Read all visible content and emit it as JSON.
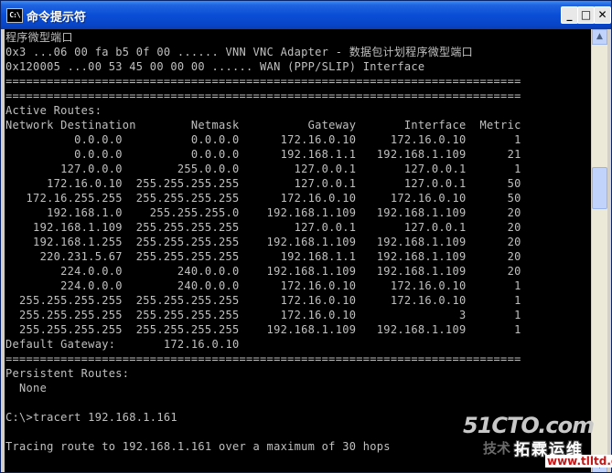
{
  "window": {
    "title": "命令提示符",
    "icon_text": "C:\\",
    "controls": {
      "minimize": "_",
      "maximize": "□",
      "close": "✕"
    }
  },
  "console": {
    "lines": [
      "程序微型端口",
      "0x3 ...06 00 fa b5 0f 00 ...... VNN VNC Adapter - 数据包计划程序微型端口",
      "0x120005 ...00 53 45 00 00 00 ...... WAN (PPP/SLIP) Interface",
      "===========================================================================",
      "===========================================================================",
      "Active Routes:",
      "Network Destination        Netmask          Gateway       Interface  Metric",
      "          0.0.0.0          0.0.0.0      172.16.0.10     172.16.0.10       1",
      "          0.0.0.0          0.0.0.0      192.168.1.1   192.168.1.109      21",
      "        127.0.0.0        255.0.0.0        127.0.0.1       127.0.0.1       1",
      "      172.16.0.10  255.255.255.255        127.0.0.1       127.0.0.1      50",
      "   172.16.255.255  255.255.255.255      172.16.0.10     172.16.0.10      50",
      "      192.168.1.0    255.255.255.0    192.168.1.109   192.168.1.109      20",
      "    192.168.1.109  255.255.255.255        127.0.0.1       127.0.0.1      20",
      "    192.168.1.255  255.255.255.255    192.168.1.109   192.168.1.109      20",
      "     220.231.5.67  255.255.255.255      192.168.1.1   192.168.1.109      20",
      "        224.0.0.0        240.0.0.0    192.168.1.109   192.168.1.109      20",
      "        224.0.0.0        240.0.0.0      172.16.0.10     172.16.0.10       1",
      "  255.255.255.255  255.255.255.255      172.16.0.10     172.16.0.10       1",
      "  255.255.255.255  255.255.255.255      172.16.0.10               3       1",
      "  255.255.255.255  255.255.255.255    192.168.1.109   192.168.1.109       1",
      "Default Gateway:       172.16.0.10",
      "===========================================================================",
      "Persistent Routes:",
      "  None",
      "",
      "C:\\>tracert 192.168.1.161",
      "",
      "Tracing route to 192.168.1.161 over a maximum of 30 hops"
    ]
  },
  "scrollbar": {
    "up_arrow": "▲",
    "down_arrow": "▼",
    "position_fraction": 0.33
  },
  "watermark": {
    "main": "51CTO.com",
    "sub1": "技术",
    "sub2": "拓霖运维",
    "url": "www.tlltd.cn"
  },
  "colors": {
    "console_bg": "#000000",
    "console_text": "#c0c0c0",
    "titlebar_blue": "#0a4ed6"
  }
}
